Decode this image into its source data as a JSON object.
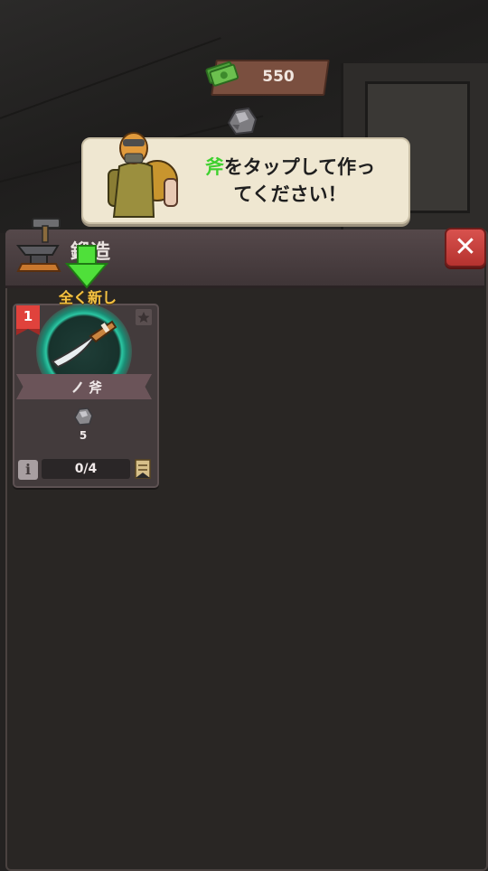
{
  "hud": {
    "money": "550"
  },
  "tutorial": {
    "text_highlight": "斧",
    "text_line1_rest": "をタップして作っ",
    "text_line2": "てください！"
  },
  "panel": {
    "title": "鍛造",
    "close_label": "✕"
  },
  "item_card": {
    "level": "1",
    "badge": "全く新し",
    "name": "斧",
    "cost": "5",
    "info_label": "i",
    "progress": "0/4",
    "progress_fraction": 0
  },
  "colors": {
    "highlight_green": "#3fd12f",
    "badge_yellow": "#f5c344",
    "close_red": "#c9403c",
    "glow_teal": "#2bc7a3"
  },
  "icons": [
    "money-icon",
    "ore-icon",
    "anvil-icon",
    "close-icon",
    "star-icon",
    "axe-icon",
    "ore-cost-icon",
    "info-icon",
    "scroll-icon",
    "pointer-arrow-icon"
  ]
}
